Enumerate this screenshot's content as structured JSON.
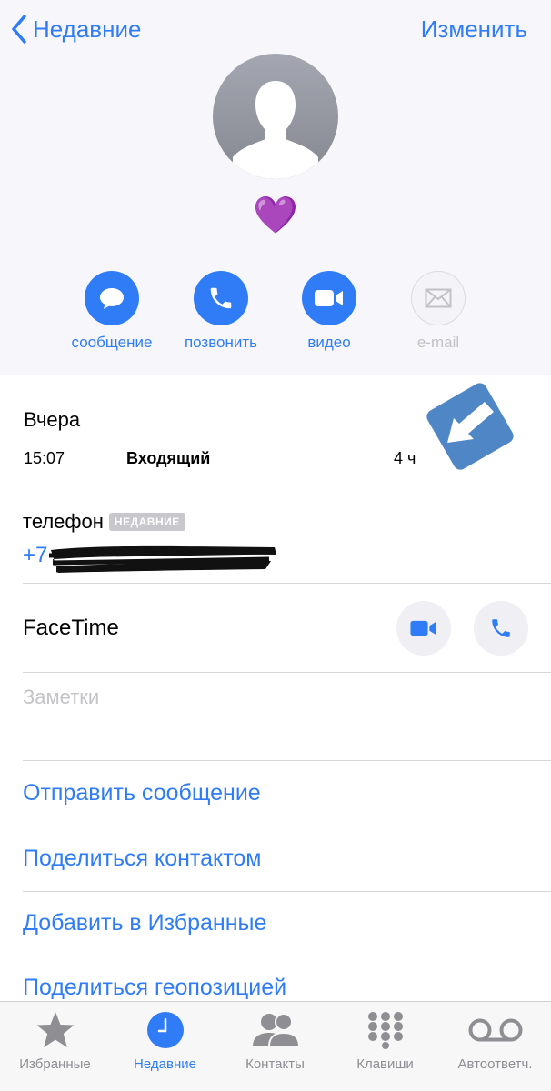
{
  "nav": {
    "back_label": "Недавние",
    "edit_label": "Изменить"
  },
  "contact": {
    "emoji": "💜"
  },
  "actions": [
    {
      "label": "сообщение",
      "icon": "message-bubble-icon"
    },
    {
      "label": "позвонить",
      "icon": "phone-icon"
    },
    {
      "label": "видео",
      "icon": "video-camera-icon"
    },
    {
      "label": "e-mail",
      "icon": "envelope-icon"
    }
  ],
  "recent_call": {
    "day": "Вчера",
    "time": "15:07",
    "type": "Входящий",
    "duration": "4 ч"
  },
  "phone": {
    "label": "телефон",
    "badge": "НЕДАВНИЕ",
    "number_visible": "+7"
  },
  "facetime": {
    "label": "FaceTime"
  },
  "notes": {
    "placeholder": "Заметки"
  },
  "links": [
    "Отправить сообщение",
    "Поделиться контактом",
    "Добавить в Избранные",
    "Поделиться геопозицией"
  ],
  "tabs": [
    {
      "label": "Избранные",
      "icon": "star-icon"
    },
    {
      "label": "Недавние",
      "icon": "clock-icon",
      "active": true
    },
    {
      "label": "Контакты",
      "icon": "contacts-icon"
    },
    {
      "label": "Клавиши",
      "icon": "keypad-icon"
    },
    {
      "label": "Автоответч.",
      "icon": "voicemail-icon"
    }
  ],
  "colors": {
    "accent": "#2f7cf6",
    "header_bg": "#f7f7fb",
    "arrow_badge": "#4f86c6"
  }
}
